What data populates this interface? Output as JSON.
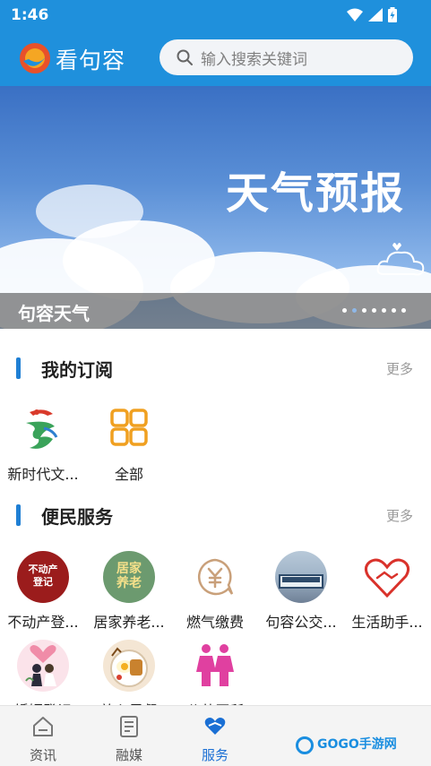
{
  "status": {
    "time": "1:46"
  },
  "header": {
    "title": "看句容",
    "search_placeholder": "输入搜索关键词"
  },
  "banner": {
    "heading": "天气预报",
    "caption": "句容天气",
    "page_count": 7,
    "active_index": 0
  },
  "subscriptions": {
    "title": "我的订阅",
    "more": "更多",
    "items": [
      {
        "label": "新时代文...",
        "icon": "new-era-logo-icon"
      },
      {
        "label": "全部",
        "icon": "grid-icon"
      }
    ]
  },
  "services": {
    "title": "便民服务",
    "more": "更多",
    "items": [
      {
        "label": "不动产登...",
        "icon_text": "不动产\n登记",
        "color": "#9b1c1c"
      },
      {
        "label": "居家养老...",
        "icon_text": "居家\n养老",
        "color": "#6c9a6f"
      },
      {
        "label": "燃气缴费",
        "icon": "yuan-bubble-icon"
      },
      {
        "label": "句容公交...",
        "icon": "bus-photo-icon"
      },
      {
        "label": "生活助手...",
        "icon": "handshake-heart-icon"
      },
      {
        "label": "婚姻登记",
        "icon": "wedding-icon"
      },
      {
        "label": "放心早餐",
        "icon": "breakfast-icon"
      },
      {
        "label": "公共厕所",
        "icon": "toilet-icon"
      }
    ]
  },
  "tabbar": {
    "tabs": [
      {
        "label": "资讯",
        "active": false
      },
      {
        "label": "融媒",
        "active": false
      },
      {
        "label": "服务",
        "active": true
      }
    ]
  },
  "watermark": "GOGO手游网",
  "colors": {
    "primary": "#1f90dc",
    "accent_bar": "#1f7fd4",
    "tab_active": "#1a6fd4"
  }
}
